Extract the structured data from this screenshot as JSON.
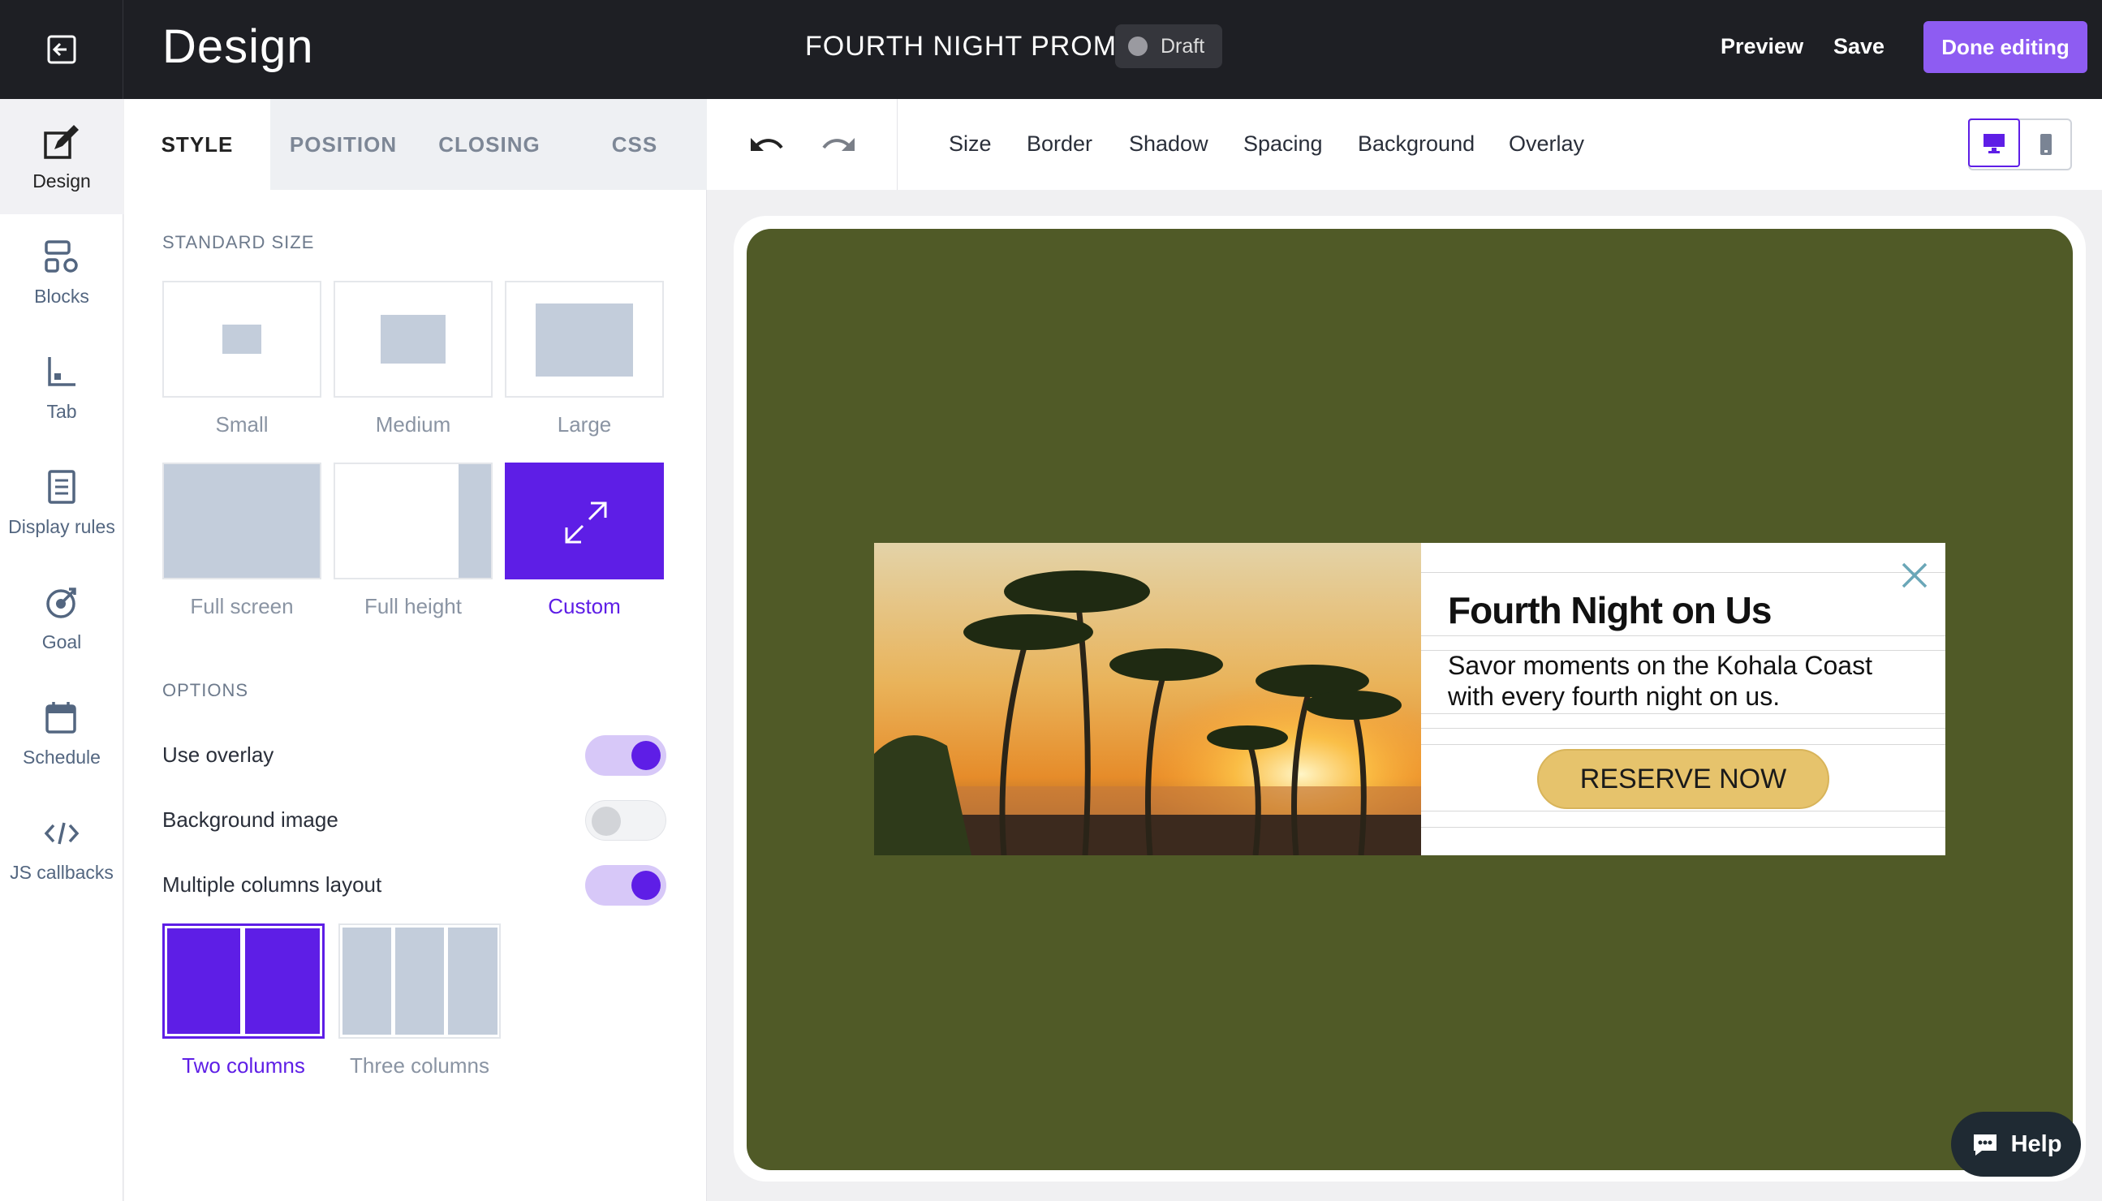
{
  "header": {
    "app_title": "Design",
    "campaign_name": "FOURTH NIGHT PROMO",
    "status": "Draft",
    "preview_label": "Preview",
    "save_label": "Save",
    "done_label": "Done editing"
  },
  "rail": {
    "items": [
      {
        "label": "Design",
        "icon": "design-icon",
        "active": true
      },
      {
        "label": "Blocks",
        "icon": "blocks-icon"
      },
      {
        "label": "Tab",
        "icon": "tab-icon"
      },
      {
        "label": "Display rules",
        "icon": "display-rules-icon"
      },
      {
        "label": "Goal",
        "icon": "goal-icon"
      },
      {
        "label": "Schedule",
        "icon": "calendar-icon"
      },
      {
        "label": "JS callbacks",
        "icon": "code-icon"
      }
    ]
  },
  "panel": {
    "tabs": [
      "STYLE",
      "POSITION",
      "CLOSING",
      "CSS"
    ],
    "active_tab": "STYLE",
    "standard_size_title": "STANDARD SIZE",
    "sizes": [
      "Small",
      "Medium",
      "Large",
      "Full screen",
      "Full height",
      "Custom"
    ],
    "selected_size": "Custom",
    "options_title": "OPTIONS",
    "options": [
      {
        "label": "Use overlay",
        "on": true
      },
      {
        "label": "Background image",
        "on": false
      },
      {
        "label": "Multiple columns layout",
        "on": true
      }
    ],
    "columns": [
      "Two columns",
      "Three columns"
    ],
    "selected_columns": "Two columns"
  },
  "toolbar": {
    "items": [
      "Size",
      "Border",
      "Shadow",
      "Spacing",
      "Background",
      "Overlay"
    ],
    "device_selected": "desktop"
  },
  "popup": {
    "title": "Fourth Night on Us",
    "text": "Savor moments on the Kohala Coast with every fourth night on us.",
    "cta": "RESERVE NOW"
  },
  "help_label": "Help",
  "colors": {
    "accent": "#5e1ee6",
    "done_button": "#8e5cf2",
    "canvas_overlay": "#505a27",
    "cta": "#e6c36c",
    "topbar": "#1e1f24"
  }
}
